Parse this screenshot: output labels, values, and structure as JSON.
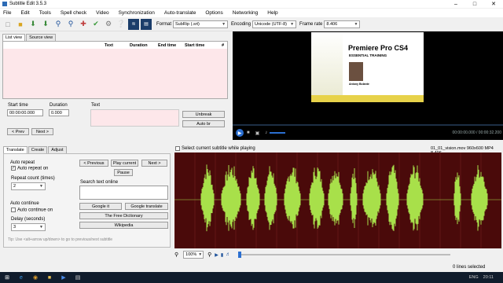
{
  "window": {
    "title": "Subtitle Edit 3.5.3"
  },
  "menu": [
    "File",
    "Edit",
    "Tools",
    "Spell check",
    "Video",
    "Synchronization",
    "Auto-translate",
    "Options",
    "Networking",
    "Help"
  ],
  "toolbar": {
    "format_label": "Format",
    "format_value": "SubRip (.srt)",
    "encoding_label": "Encoding",
    "encoding_value": "Unicode (UTF-8)",
    "framerate_label": "Frame rate",
    "framerate_value": "8.406"
  },
  "left_tabs": [
    "List view",
    "Source view"
  ],
  "grid": {
    "columns": [
      "#",
      "Start time",
      "End time",
      "Duration",
      "Text"
    ]
  },
  "editor": {
    "start_time_label": "Start time",
    "start_time_value": "00:00:00.000",
    "duration_label": "Duration",
    "duration_value": "0.000",
    "text_label": "Text",
    "unbreak": "Unbreak",
    "auto_br": "Auto br",
    "prev": "< Prev",
    "next": "Next >"
  },
  "video": {
    "slide_title": "Premiere Pro CS4",
    "slide_subtitle": "ESSENTIAL TRAINING",
    "author": "Antony Bolante",
    "time": "00:00:00.000 / 00:00:32.200"
  },
  "bottom_tabs": [
    "Translate",
    "Create",
    "Adjust"
  ],
  "translate": {
    "auto_repeat_title": "Auto repeat",
    "auto_repeat_on": "Auto repeat on",
    "repeat_count_label": "Repeat count (times)",
    "repeat_count_value": "2",
    "auto_continue_title": "Auto continue",
    "auto_continue_on": "Auto continue on",
    "delay_label": "Delay (seconds)",
    "delay_value": "3",
    "prev_btn": "< Previous",
    "play_current": "Play current",
    "next_btn": "Next >",
    "pause": "Pause",
    "search_label": "Search text online",
    "google_it": "Google it",
    "google_translate": "Google translate",
    "free_dictionary": "The Free Dictionary",
    "wikipedia": "Wikipedia",
    "tip": "Tip: Use <alt+arrow up/down> to go to previous/next subtitle"
  },
  "waveform": {
    "select_current": "Select current subtitle while playing",
    "file_info": "01_01_vision.mov 960x600 MP4 8.406",
    "zoom_value": "100%"
  },
  "status": {
    "lines_selected": "0 lines selected"
  },
  "taskbar": {
    "lang": "ENG",
    "time": "20:11"
  },
  "colors": {
    "waveform_bg": "#4a0a0a",
    "waveform_line": "#a8e04a",
    "grid_pink": "#fde7ea"
  }
}
